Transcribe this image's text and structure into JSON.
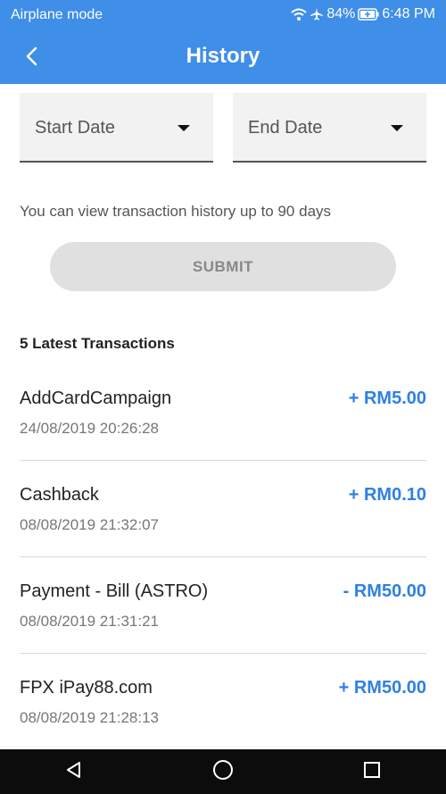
{
  "status_bar": {
    "left_text": "Airplane mode",
    "battery": "84%",
    "time": "6:48 PM",
    "icons": [
      "wifi-icon",
      "airplane-icon",
      "battery-icon"
    ]
  },
  "header": {
    "title": "History",
    "back_icon": "chevron-left-icon"
  },
  "filters": {
    "start_date_label": "Start Date",
    "end_date_label": "End Date"
  },
  "info_text": "You can view transaction history up to 90 days",
  "submit_label": "SUBMIT",
  "transactions_heading": "5 Latest Transactions",
  "transactions": [
    {
      "name": "AddCardCampaign",
      "date": "24/08/2019 20:26:28",
      "amount": "+ RM5.00"
    },
    {
      "name": "Cashback",
      "date": "08/08/2019 21:32:07",
      "amount": "+ RM0.10"
    },
    {
      "name": "Payment - Bill (ASTRO)",
      "date": "08/08/2019 21:31:21",
      "amount": "- RM50.00"
    },
    {
      "name": "FPX iPay88.com",
      "date": "08/08/2019 21:28:13",
      "amount": "+ RM50.00"
    }
  ],
  "colors": {
    "primary": "#3f8ee8",
    "amount": "#2f80e5",
    "nav_bar": "#0c0c0c"
  },
  "nav_bar": {
    "icons": [
      "back-triangle-icon",
      "home-circle-icon",
      "recents-square-icon"
    ]
  }
}
